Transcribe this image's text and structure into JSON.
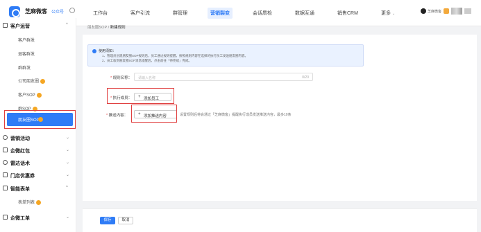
{
  "brand": {
    "name": "芝麻微客",
    "public_account": "公众号"
  },
  "nav": {
    "items": [
      {
        "label": "工作台"
      },
      {
        "label": "客户引流"
      },
      {
        "label": "群管理"
      },
      {
        "label": "营销裂变"
      },
      {
        "label": "会话质检"
      },
      {
        "label": "数据互通"
      },
      {
        "label": "销售CRM"
      },
      {
        "label": "更多"
      }
    ],
    "more_chevron": "⌄"
  },
  "user": {
    "name": "芝麻微客"
  },
  "sidebar": {
    "groups": [
      {
        "label": "客户运营",
        "chevron": "^"
      },
      {
        "label": "营销活动",
        "chevron": "⌄"
      },
      {
        "label": "企微红包",
        "chevron": "⌄"
      },
      {
        "label": "雷达话术",
        "chevron": "⌄"
      },
      {
        "label": "门店优惠券",
        "chevron": "⌄"
      },
      {
        "label": "智能表单",
        "chevron": "^"
      },
      {
        "label": "企微工单",
        "chevron": "⌄"
      }
    ],
    "items": [
      {
        "label": "客户群发"
      },
      {
        "label": "退客群发"
      },
      {
        "label": "群群发"
      },
      {
        "label": "公司朋友圈"
      },
      {
        "label": "客户SOP"
      },
      {
        "label": "群SOP"
      },
      {
        "label": "朋友圈SOP"
      },
      {
        "label": "表单列表"
      }
    ]
  },
  "breadcrumb": {
    "parent": "朋友圈SOP",
    "sep": "/",
    "current": "新建规则"
  },
  "notice": {
    "title": "使用须知：",
    "line1": "1、管理员创建朋友圈SOP规则后，员工通过规则提醒，按照规则内容在选择的执行员工发送朋友圈内容。",
    "line2": "2、员工收到朋友圈SOP消息提醒后，点击前往「待完成」完成。"
  },
  "form": {
    "rule_name_label": "规则名称：",
    "rule_name_placeholder": "请输入名称",
    "rule_name_count": "0/20",
    "executor_label": "执行成员：",
    "add_employee": "添加员工",
    "push_label": "推送内容：",
    "add_push": "添加推送内容",
    "push_hint": "设置规则后将会通过「芝麻微客」提醒执行成员发送推送内容，最多10条"
  },
  "footer": {
    "save": "保存",
    "cancel": "取消"
  }
}
